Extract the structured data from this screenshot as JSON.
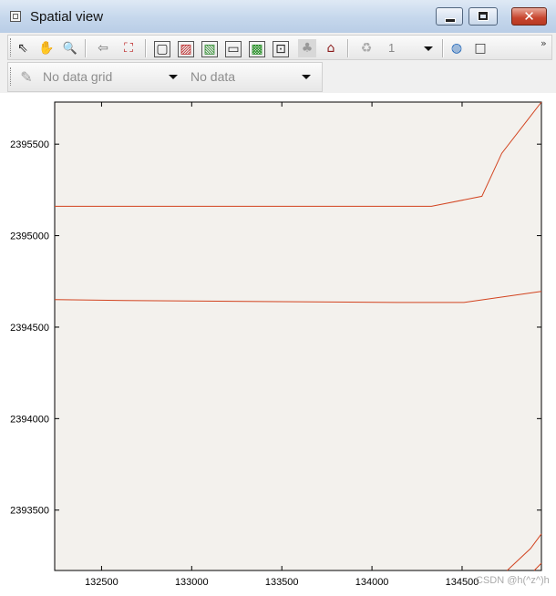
{
  "window": {
    "title": "Spatial view",
    "close_glyph": "✕"
  },
  "toolbar": {
    "tools": [
      {
        "name": "select-arrow-icon",
        "glyph": "⇖"
      },
      {
        "name": "pan-hand-icon",
        "glyph": "✋"
      },
      {
        "name": "zoom-magnifier-icon",
        "glyph": "🔍"
      },
      {
        "name": "back-arrow-icon",
        "glyph": "⇦"
      },
      {
        "name": "zoom-extent-icon",
        "glyph": "⛶"
      },
      {
        "name": "select-box-icon",
        "glyph": "▢"
      },
      {
        "name": "layer-pattern-icon",
        "glyph": "▨"
      },
      {
        "name": "layer-green-icon",
        "glyph": "▧"
      },
      {
        "name": "polygon-icon",
        "glyph": "▭"
      },
      {
        "name": "grid-green-icon",
        "glyph": "▩"
      },
      {
        "name": "point-layer-icon",
        "glyph": "⊡"
      },
      {
        "name": "tree-icon",
        "glyph": "♣"
      },
      {
        "name": "house-icon",
        "glyph": "⌂"
      },
      {
        "name": "recycle-icon",
        "glyph": "♻"
      },
      {
        "name": "globe-icon",
        "glyph": "◍"
      },
      {
        "name": "frame-icon",
        "glyph": "□"
      }
    ],
    "layer_index": "1",
    "overflow_glyph": "»"
  },
  "data_bar": {
    "grid_icon": "data-grid-icon",
    "grid_select": "No data grid",
    "data_select": "No data"
  },
  "colors": {
    "plot_background": "#f3f1ed",
    "line_color": "#d2431f"
  },
  "chart_data": {
    "type": "line",
    "title": "",
    "xlabel": "",
    "ylabel": "",
    "xlim": [
      132240,
      134940
    ],
    "ylim": [
      2393170,
      2395730
    ],
    "x_ticks": [
      "132500",
      "133000",
      "133500",
      "134000",
      "134500"
    ],
    "y_ticks": [
      "2393500",
      "2394000",
      "2394500",
      "2395000",
      "2395500"
    ],
    "series": [
      {
        "x": [
          132240,
          134330,
          134610,
          134720,
          134940
        ],
        "y": [
          2395160,
          2395160,
          2395215,
          2395450,
          2395730
        ]
      },
      {
        "x": [
          132240,
          132630,
          133390,
          134140,
          134510,
          134940
        ],
        "y": [
          2394650,
          2394645,
          2394640,
          2394635,
          2394635,
          2394695
        ]
      },
      {
        "x": [
          134750,
          134880,
          134940
        ],
        "y": [
          2393170,
          2393290,
          2393370
        ]
      },
      {
        "x": [
          134900,
          134940
        ],
        "y": [
          2393170,
          2393210
        ]
      }
    ]
  },
  "watermark": "CSDN @h(^z^)h"
}
